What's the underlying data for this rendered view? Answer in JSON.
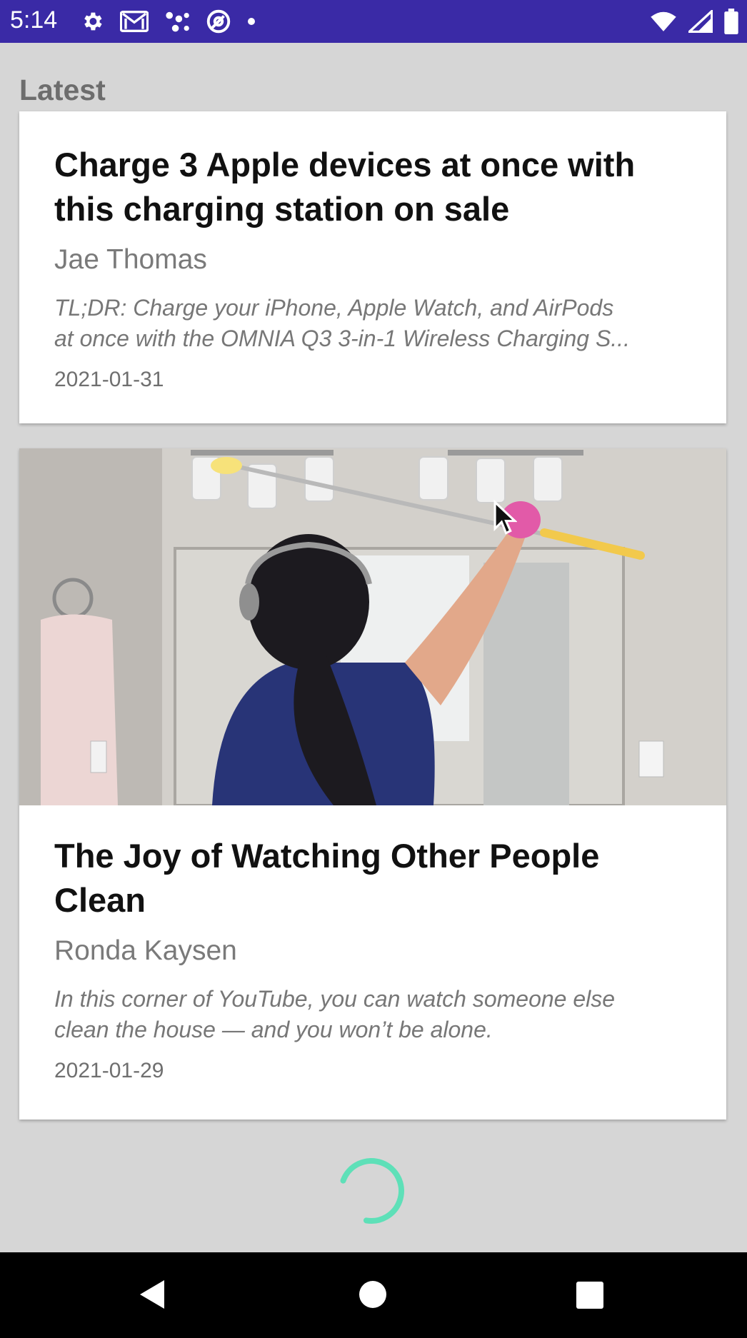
{
  "status_bar": {
    "time": "5:14",
    "background": "#3a2aa6",
    "icons_left": [
      "gear-icon",
      "gmail-icon",
      "connection-dots-icon",
      "at-sign-icon",
      "dot-icon"
    ],
    "icons_right": [
      "wifi-icon",
      "cell-signal-icon",
      "battery-icon"
    ]
  },
  "section": {
    "title": "Latest"
  },
  "articles": [
    {
      "headline": "Charge 3 Apple devices at once with this charging station on sale",
      "author": "Jae Thomas",
      "summary_line_1": "TL;DR: Charge your iPhone, Apple Watch, and AirPods",
      "summary_line_2": "at once with the OMNIA Q3 3-in-1 Wireless Charging S...",
      "date": "2021-01-31"
    },
    {
      "headline": "The Joy of Watching Other People Clean",
      "author": "Ronda Kaysen",
      "summary_line_1": "In this corner of YouTube, you can watch someone else",
      "summary_line_2": "clean the house — and you won’t be alone.",
      "date": "2021-01-29"
    }
  ],
  "loading": {
    "spinner_color": "#5ee0b8"
  },
  "nav_bar": {
    "buttons": [
      "back-icon",
      "home-icon",
      "recents-icon"
    ]
  }
}
